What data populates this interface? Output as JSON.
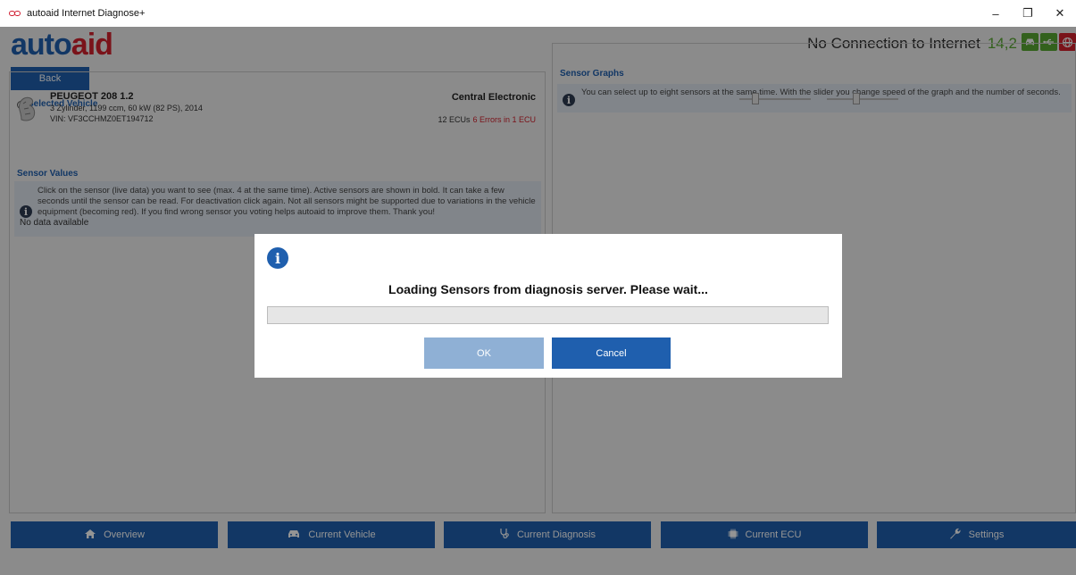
{
  "window": {
    "title": "autoaid Internet Diagnose+",
    "controls": [
      "–",
      "❐",
      "✕"
    ]
  },
  "header": {
    "logo_part1": "auto",
    "logo_part2": "aid",
    "connection_text": "No Connection to Internet",
    "voltage": "14,2 V",
    "status_icons": [
      "car-icon",
      "usb-icon",
      "globe-icon"
    ]
  },
  "back_label": "Back",
  "selected_vehicle": {
    "legend": "Selected Vehicle",
    "name": "PEUGEOT 208 1.2",
    "specs": "3 Zylinder, 1199 ccm, 60 kW (82 PS), 2014",
    "vin": "VIN: VF3CCHMZ0ET194712",
    "system": "Central Electronic",
    "ecu_count": "12 ECUs",
    "errors": "6 Errors in 1 ECU"
  },
  "sensor_values": {
    "legend": "Sensor Values",
    "info": "Click on the sensor (live data) you want to see (max. 4 at the same time). Active sensors are shown in bold. It can take a few seconds until the sensor can be read. For deactivation click again. Not all sensors might be supported due to variations in the vehicle equipment (becoming red). If you find wrong sensor you voting helps autoaid to improve them. Thank you!",
    "empty": "No data available"
  },
  "sensor_graphs": {
    "legend": "Sensor Graphs",
    "info": "You can select up to eight sensors at the same time. With the slider you change speed of the graph and the number of seconds.",
    "speed_slider": 0.2,
    "seconds_slider": 0.4
  },
  "bottom_nav": [
    {
      "label": "Overview",
      "icon": "home-icon"
    },
    {
      "label": "Current Vehicle",
      "icon": "car-icon"
    },
    {
      "label": "Current Diagnosis",
      "icon": "stethoscope-icon"
    },
    {
      "label": "Current ECU",
      "icon": "chip-icon"
    },
    {
      "label": "Settings",
      "icon": "wrench-icon"
    }
  ],
  "dialog": {
    "message": "Loading Sensors from diagnosis server. Please wait...",
    "progress": 0,
    "ok_label": "OK",
    "cancel_label": "Cancel"
  },
  "colors": {
    "brand_blue": "#1f5fae",
    "brand_red": "#d3222e",
    "voltage_green": "#58a732"
  }
}
